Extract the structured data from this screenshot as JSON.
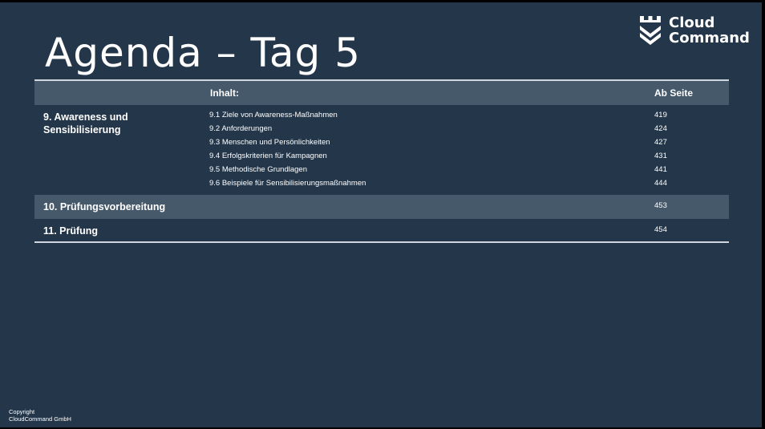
{
  "title": "Agenda – Tag 5",
  "logo": {
    "line1": "Cloud",
    "line2": "Command",
    "icon": "shield-icon"
  },
  "table": {
    "header": {
      "content": "Inhalt:",
      "page": "Ab Seite"
    },
    "section9": {
      "title_line1": "9. Awareness und",
      "title_line2": "Sensibilisierung",
      "items": [
        {
          "label": "9.1 Ziele von Awareness-Maßnahmen",
          "page": "419"
        },
        {
          "label": "9.2 Anforderungen",
          "page": "424"
        },
        {
          "label": "9.3 Menschen und Persönlichkeiten",
          "page": "427"
        },
        {
          "label": "9.4 Erfolgskriterien für Kampagnen",
          "page": "431"
        },
        {
          "label": "9.5 Methodische Grundlagen",
          "page": "441"
        },
        {
          "label": "9.6 Beispiele für Sensibilisierungsmaßnahmen",
          "page": "444"
        }
      ]
    },
    "section10": {
      "title": "10. Prüfungsvorbereitung",
      "page": "453"
    },
    "section11": {
      "title": "11. Prüfung",
      "page": "454"
    }
  },
  "footer": {
    "line1": "Copyright",
    "line2": "CloudCommand GmbH"
  },
  "colors": {
    "background": "#243649",
    "band": "#46596a",
    "text": "#ffffff"
  }
}
